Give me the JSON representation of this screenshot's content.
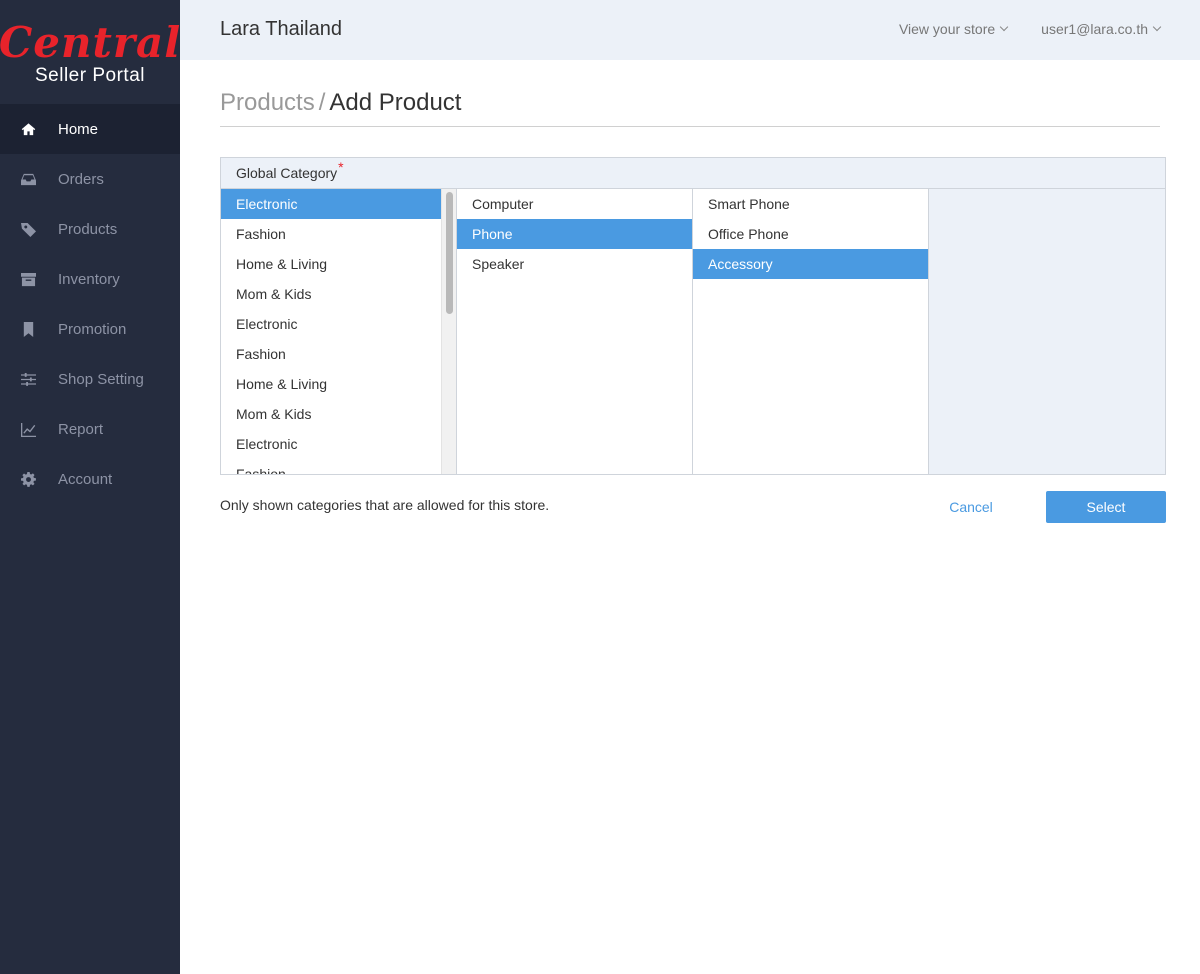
{
  "brand": {
    "logo_text": "Central",
    "subtitle": "Seller Portal",
    "logo_color": "#e8232b"
  },
  "sidebar": {
    "background": "#252c3e",
    "items": [
      {
        "label": "Home",
        "icon": "home-icon",
        "active": true
      },
      {
        "label": "Orders",
        "icon": "inbox-icon",
        "active": false
      },
      {
        "label": "Products",
        "icon": "tag-icon",
        "active": false
      },
      {
        "label": "Inventory",
        "icon": "archive-icon",
        "active": false
      },
      {
        "label": "Promotion",
        "icon": "bookmark-icon",
        "active": false
      },
      {
        "label": "Shop Setting",
        "icon": "sliders-icon",
        "active": false
      },
      {
        "label": "Report",
        "icon": "line-chart-icon",
        "active": false
      },
      {
        "label": "Account",
        "icon": "gear-icon",
        "active": false
      }
    ]
  },
  "header": {
    "store_name": "Lara Thailand",
    "view_store": "View your store",
    "user_email": "user1@lara.co.th"
  },
  "breadcrumb": {
    "parent": "Products",
    "separator": "/",
    "current": "Add Product"
  },
  "category_panel": {
    "label": "Global Category",
    "required_mark": "*",
    "columns": [
      {
        "items": [
          "Electronic",
          "Fashion",
          "Home & Living",
          "Mom & Kids",
          "Electronic",
          "Fashion",
          "Home & Living",
          "Mom & Kids",
          "Electronic",
          "Fashion"
        ],
        "selected": "Electronic"
      },
      {
        "items": [
          "Computer",
          "Phone",
          "Speaker"
        ],
        "selected": "Phone"
      },
      {
        "items": [
          "Smart Phone",
          "Office Phone",
          "Accessory"
        ],
        "selected": "Accessory"
      }
    ]
  },
  "footer": {
    "note": "Only shown categories that are allowed for this store.",
    "cancel_label": "Cancel",
    "select_label": "Select"
  },
  "colors": {
    "accent": "#4a9ae1",
    "header_bg": "#ecf1f8"
  }
}
